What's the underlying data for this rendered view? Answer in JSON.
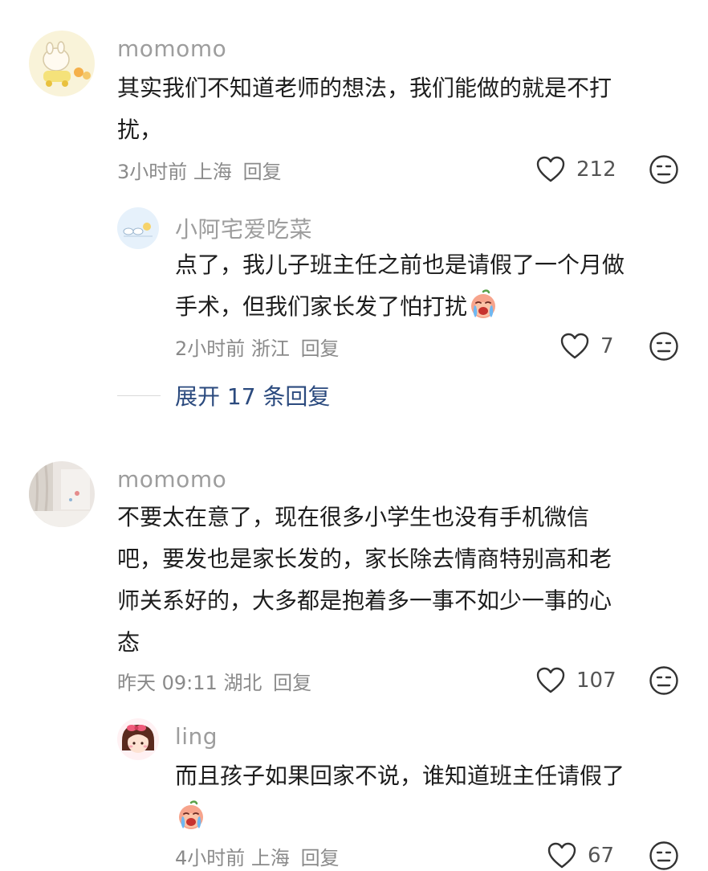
{
  "comments": [
    {
      "username": "momomo",
      "lines": [
        "其实我们不知道老师的想法，我们能做的就是不打",
        "扰，"
      ],
      "time": "3小时前",
      "location": "上海",
      "reply_label": "回复",
      "likes": "212",
      "replies": [
        {
          "username": "小阿宅爱吃菜",
          "lines": [
            "点了，我儿子班主任之前也是请假了一个月做",
            "手术，但我们家长发了怕打扰"
          ],
          "time": "2小时前",
          "location": "浙江",
          "reply_label": "回复",
          "likes": "7"
        }
      ],
      "expand_label": "展开 17 条回复"
    },
    {
      "username": "momomo",
      "lines": [
        "不要太在意了，现在很多小学生也没有手机微信",
        "吧，要发也是家长发的，家长除去情商特别高和老",
        "师关系好的，大多都是抱着多一事不如少一事的心",
        "态"
      ],
      "time": "昨天 09:11",
      "location": "湖北",
      "reply_label": "回复",
      "likes": "107",
      "replies": [
        {
          "username": "ling",
          "lines": [
            "而且孩子如果回家不说，谁知道班主任请假了"
          ],
          "time": "4小时前",
          "location": "上海",
          "reply_label": "回复",
          "likes": "67"
        }
      ]
    }
  ],
  "icons": {
    "like": "heart-outline-icon",
    "dislike": "unhappy-face-icon",
    "emoji": "crying-face-emoji"
  },
  "colors": {
    "username": "#9d9d9d",
    "meta": "#8a8a8a",
    "expand_link": "#2b4a7e"
  }
}
